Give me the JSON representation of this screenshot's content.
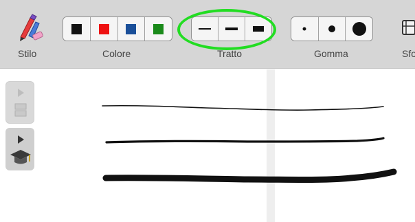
{
  "toolbar": {
    "groups": {
      "pen": "Stilo",
      "color": "Colore",
      "stroke": "Tratto",
      "eraser": "Gomma",
      "background": "Sfo"
    },
    "colors": [
      "#111111",
      "#ee1111",
      "#1a4f99",
      "#1a8a1a"
    ],
    "highlight_color": "#22dd22"
  },
  "canvas": {
    "ink_color": "#111111"
  }
}
